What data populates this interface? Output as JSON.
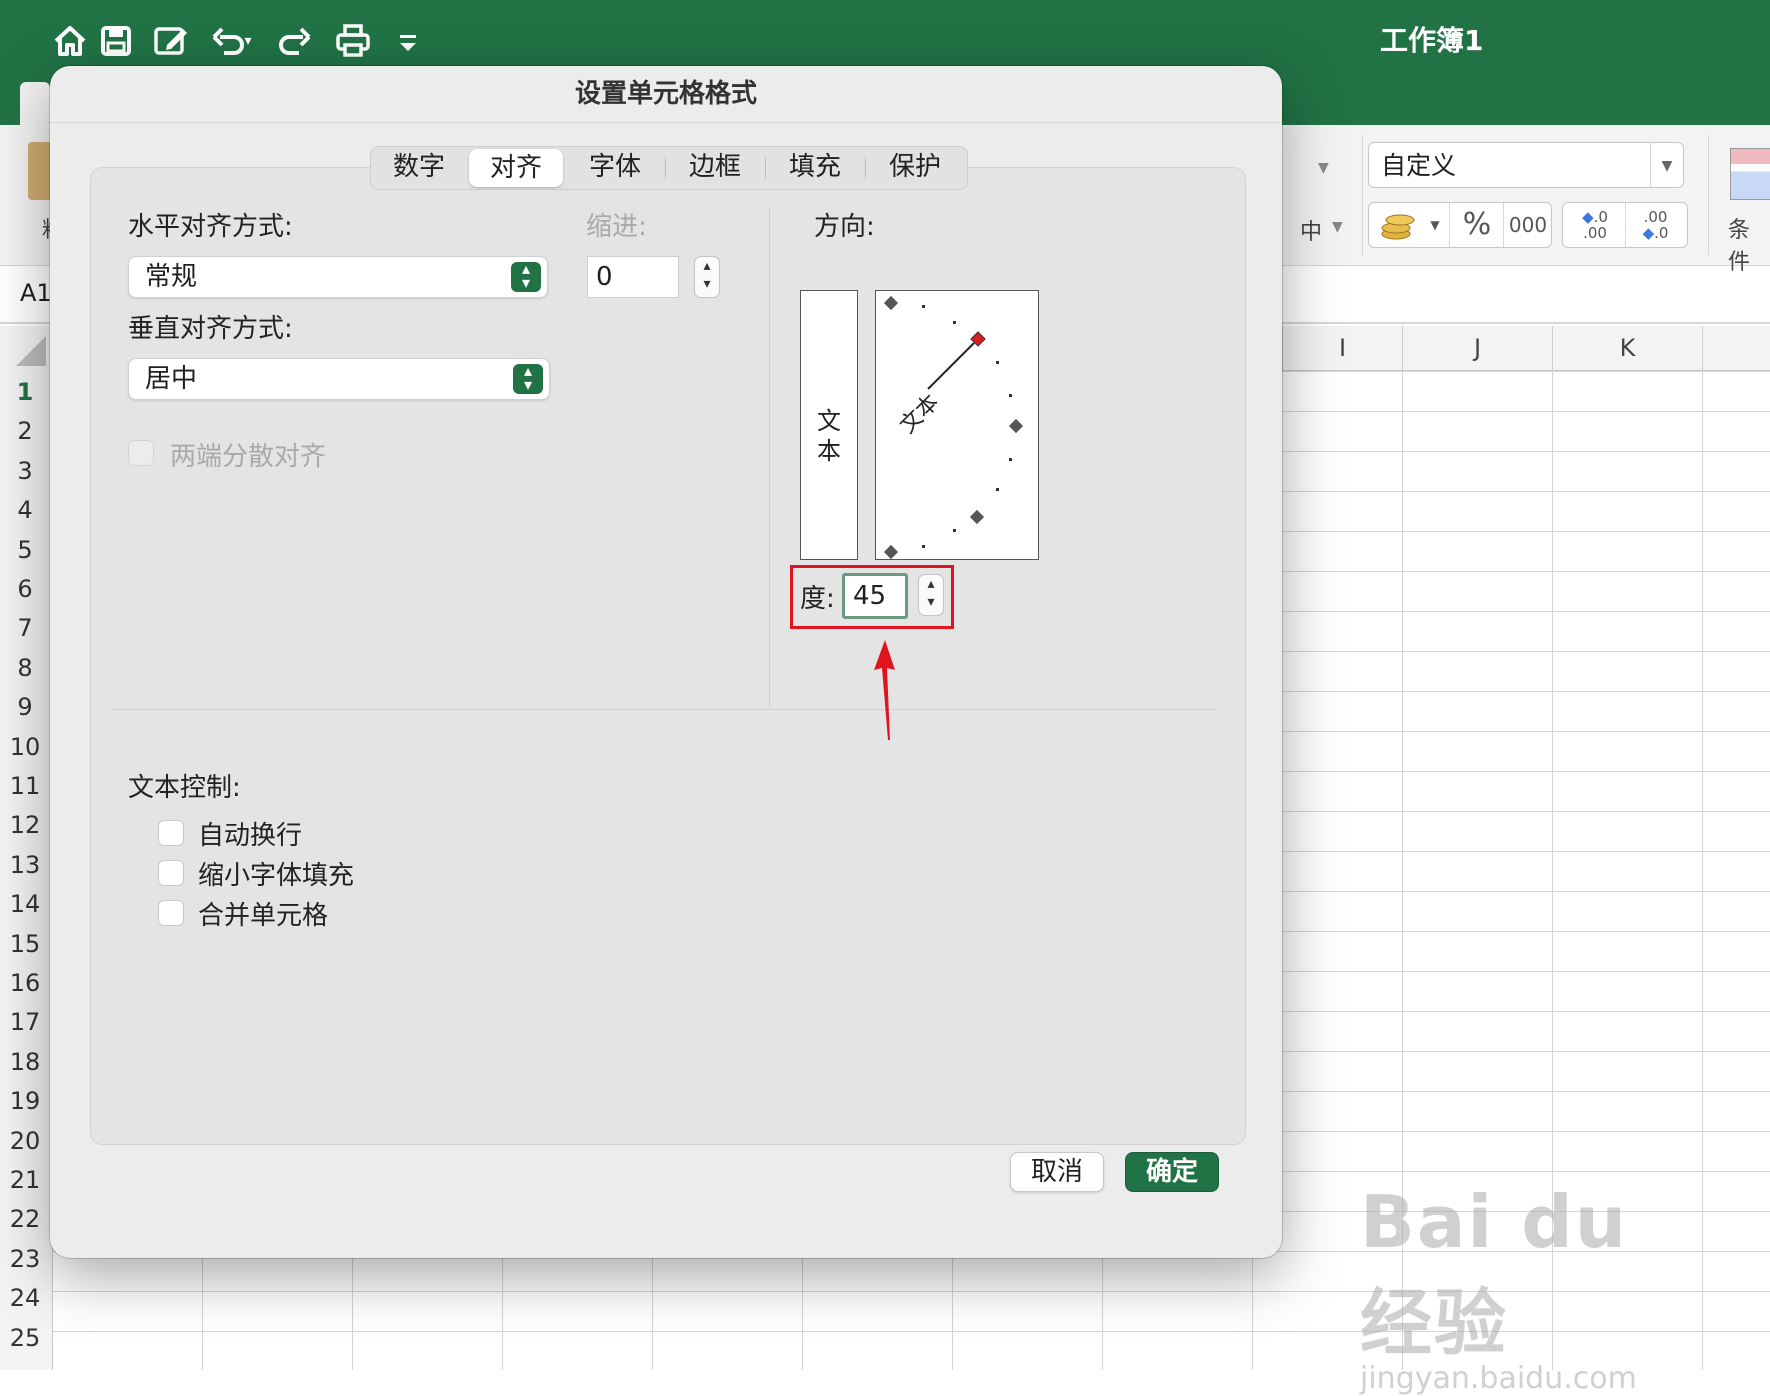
{
  "app": {
    "workbook_title": "工作簿1",
    "accent_color": "#217346"
  },
  "quick_access": {
    "icons": [
      "home-icon",
      "save-icon",
      "edit-icon",
      "undo-icon",
      "redo-icon",
      "print-icon",
      "customize-icon"
    ]
  },
  "ribbon": {
    "number_format_value": "自定义",
    "percent_label": "%",
    "comma_label": "000",
    "increase_decimal_top": ".0",
    "increase_decimal_bottom": ".00",
    "decrease_decimal_top": ".00",
    "decrease_decimal_bottom": ".0",
    "merge_partial": "中",
    "conditional_partial": "条件",
    "paste_partial": "粘"
  },
  "formula_bar": {
    "name_box": "A1"
  },
  "grid": {
    "columns": [
      "I",
      "J",
      "K"
    ],
    "rows": [
      "1",
      "2",
      "3",
      "4",
      "5",
      "6",
      "7",
      "8",
      "9",
      "10",
      "11",
      "12",
      "13",
      "14",
      "15",
      "16",
      "17",
      "18",
      "19",
      "20",
      "21",
      "22",
      "23",
      "24",
      "25"
    ],
    "active_row": "1"
  },
  "dialog": {
    "title": "设置单元格格式",
    "tabs": [
      "数字",
      "对齐",
      "字体",
      "边框",
      "填充",
      "保护"
    ],
    "active_tab": "对齐",
    "horizontal_label": "水平对齐方式:",
    "horizontal_value": "常规",
    "indent_label": "缩进:",
    "indent_value": "0",
    "vertical_label": "垂直对齐方式:",
    "vertical_value": "居中",
    "distributed_label": "两端分散对齐",
    "orientation_label": "方向:",
    "vertical_text_chars": [
      "文",
      "本"
    ],
    "dial_text": "文本",
    "degree_label": "度:",
    "degree_value": "45",
    "text_control_label": "文本控制:",
    "checkboxes": [
      "自动换行",
      "缩小字体填充",
      "合并单元格"
    ],
    "cancel_label": "取消",
    "ok_label": "确定"
  },
  "watermark": {
    "main": "Bai du 经验",
    "sub": "jingyan.baidu.com"
  }
}
